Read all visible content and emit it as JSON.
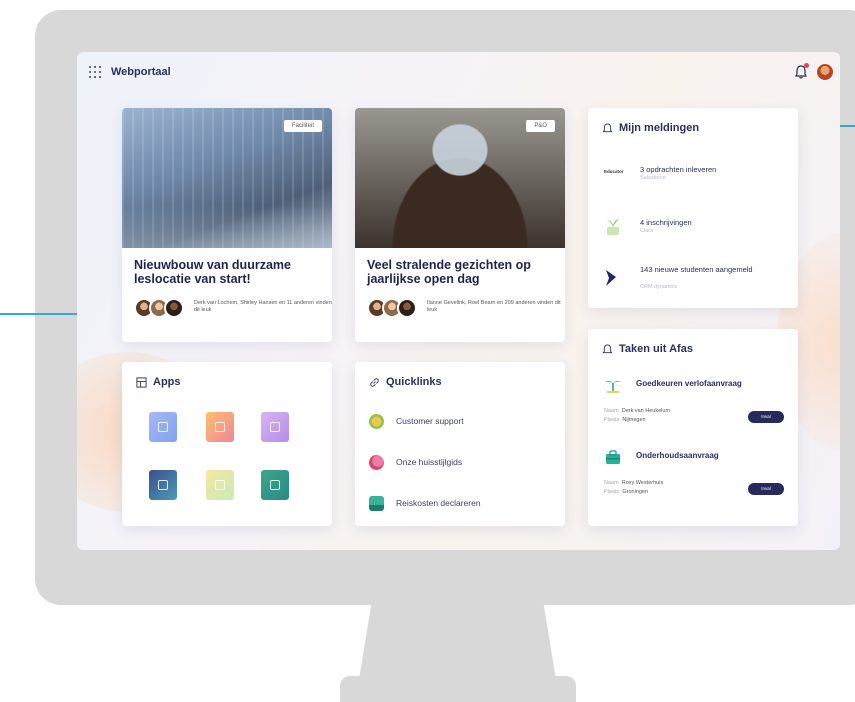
{
  "app": {
    "title": "Webportaal"
  },
  "news": [
    {
      "tag": "Faciliteit",
      "title": "Nieuwbouw van duurzame leslocatie van start!",
      "likes": "Derk van Lochem, Shirley Hansen en 11 anderen vinden dit leuk"
    },
    {
      "tag": "P&O",
      "title": "Veel stralende gezichten op jaarlijkse open dag",
      "likes": "Ilanne Gevelink, Roel Bearn en 209 anderen vinden dit leuk"
    }
  ],
  "apps": {
    "title": "Apps"
  },
  "quicklinks": {
    "title": "Quicklinks",
    "items": [
      "Customer support",
      "Onze huisstijlgids",
      "Reiskosten declareren"
    ]
  },
  "notifications": {
    "title": "Mijn meldingen",
    "items": [
      {
        "logo": "Educator",
        "title": "3 opdrachten inleveren",
        "source": "Salesforce"
      },
      {
        "logo": "",
        "title": "4 inschrijvingen",
        "source": "Clara"
      },
      {
        "logo": "",
        "title": "143 nieuwe studenten aangemeld",
        "source": "CRM dynamics"
      }
    ]
  },
  "tasks": {
    "title": "Taken uit Afas",
    "items": [
      {
        "title": "Goedkeuren verlofaanvraag",
        "name_label": "Naam",
        "name": "Derk van Heukelum",
        "place_label": "Plaats",
        "place": "Nijmegen",
        "button": "Inval"
      },
      {
        "title": "Onderhoudsaanvraag",
        "name_label": "Naam",
        "name": "Roxy Westerhuis",
        "place_label": "Plaats",
        "place": "Groningen",
        "button": "Inval"
      }
    ]
  },
  "colors": {
    "accent": "#262a5c",
    "callout": "#36a7d9"
  }
}
